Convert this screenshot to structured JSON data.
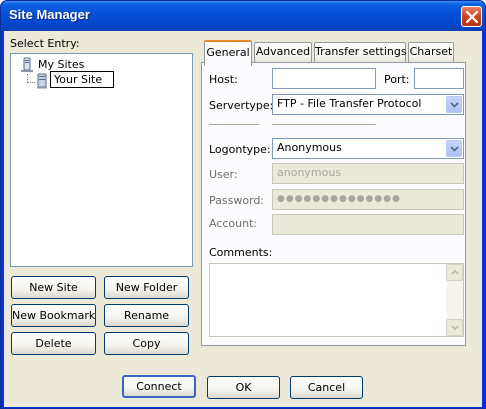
{
  "window": {
    "title": "Site Manager"
  },
  "left": {
    "select_entry_label": "Select Entry:",
    "tree": {
      "root_label": "My Sites",
      "child_label": "Your Site"
    },
    "buttons": {
      "new_site": "New Site",
      "new_folder": "New Folder",
      "new_bookmark": "New Bookmark",
      "rename": "Rename",
      "delete": "Delete",
      "copy": "Copy"
    }
  },
  "tabs": [
    {
      "label": "General",
      "active": true
    },
    {
      "label": "Advanced",
      "active": false
    },
    {
      "label": "Transfer settings",
      "active": false
    },
    {
      "label": "Charset",
      "active": false
    }
  ],
  "general": {
    "host_label": "Host:",
    "host_value": "",
    "port_label": "Port:",
    "port_value": "",
    "servertype_label": "Servertype:",
    "servertype_value": "FTP - File Transfer Protocol",
    "logontype_label": "Logontype:",
    "logontype_value": "Anonymous",
    "user_label": "User:",
    "user_value": "anonymous",
    "password_label": "Password:",
    "password_value": "●●●●●●●●●●●●●●",
    "account_label": "Account:",
    "account_value": "",
    "comments_label": "Comments:",
    "comments_value": ""
  },
  "footer": {
    "connect": "Connect",
    "ok": "OK",
    "cancel": "Cancel"
  },
  "colors": {
    "titlebar": "#0550d8",
    "client_bg": "#ece9d8",
    "active_tab_accent": "#e68b2c",
    "close_button": "#c8431b"
  }
}
